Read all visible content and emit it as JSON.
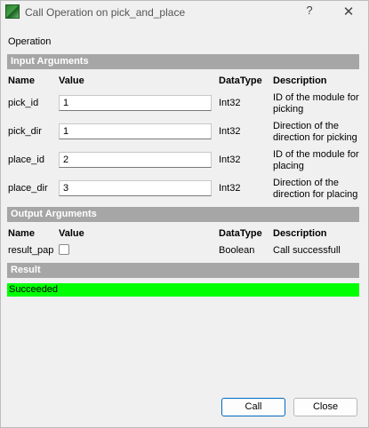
{
  "window": {
    "title": "Call Operation on pick_and_place",
    "help": "?",
    "close": "✕"
  },
  "operation_label": "Operation",
  "input_section": {
    "title": "Input Arguments",
    "headers": {
      "name": "Name",
      "value": "Value",
      "datatype": "DataType",
      "description": "Description"
    },
    "rows": [
      {
        "name": "pick_id",
        "value": "1",
        "datatype": "Int32",
        "description": "ID of the module for picking"
      },
      {
        "name": "pick_dir",
        "value": "1",
        "datatype": "Int32",
        "description": "Direction of the direction for picking"
      },
      {
        "name": "place_id",
        "value": "2",
        "datatype": "Int32",
        "description": "ID of the module for placing"
      },
      {
        "name": "place_dir",
        "value": "3",
        "datatype": "Int32",
        "description": "Direction of the direction for placing"
      }
    ]
  },
  "output_section": {
    "title": "Output Arguments",
    "headers": {
      "name": "Name",
      "value": "Value",
      "datatype": "DataType",
      "description": "Description"
    },
    "rows": [
      {
        "name": "result_pap",
        "checked": false,
        "datatype": "Boolean",
        "description": "Call successfull"
      }
    ]
  },
  "result_section": {
    "title": "Result",
    "status": "Succeeded",
    "status_color": "#00ff00"
  },
  "buttons": {
    "call": "Call",
    "close": "Close"
  }
}
